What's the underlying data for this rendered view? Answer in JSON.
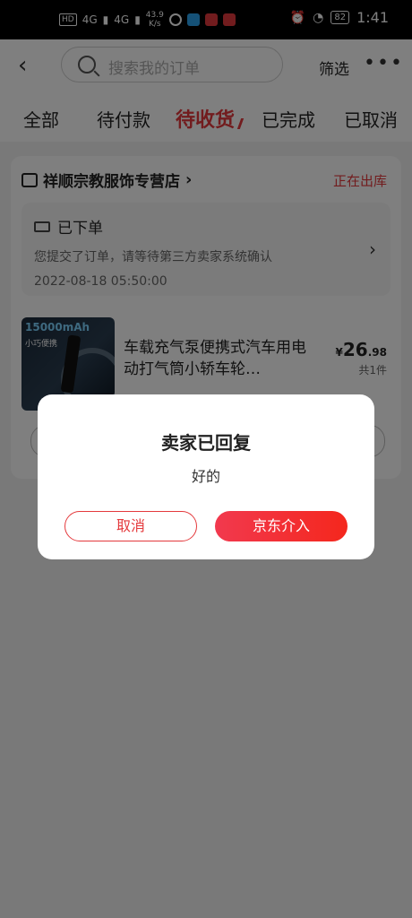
{
  "status_bar": {
    "hd_label": "HD",
    "net1": "4G",
    "net2": "4G",
    "speed_value": "43.9",
    "speed_unit": "K/s",
    "battery": "82",
    "time": "1:41"
  },
  "search": {
    "placeholder": "搜索我的订单",
    "filter_label": "筛选",
    "more_label": "•••"
  },
  "tabs": [
    {
      "label": "全部"
    },
    {
      "label": "待付款"
    },
    {
      "label": "待收货"
    },
    {
      "label": "已完成"
    },
    {
      "label": "已取消"
    }
  ],
  "order": {
    "store_name": "祥顺宗教服饰专营店",
    "status": "正在出库",
    "track_title": "已下单",
    "track_desc": "您提交了订单，请等待第三方卖家系统确认",
    "track_time": "2022-08-18 05:50:00",
    "product_title": "车载充气泵便携式汽车用电动打气筒小轿车轮…",
    "thumb_capacity": "15000mAh",
    "thumb_tag": "小巧便携",
    "price_symbol": "¥",
    "price_int": "26",
    "price_dec": ".98",
    "quantity": "共1件"
  },
  "dialog": {
    "title": "卖家已回复",
    "message": "好的",
    "cancel_label": "取消",
    "confirm_label": "京东介入"
  },
  "colors": {
    "accent": "#e4393c"
  }
}
